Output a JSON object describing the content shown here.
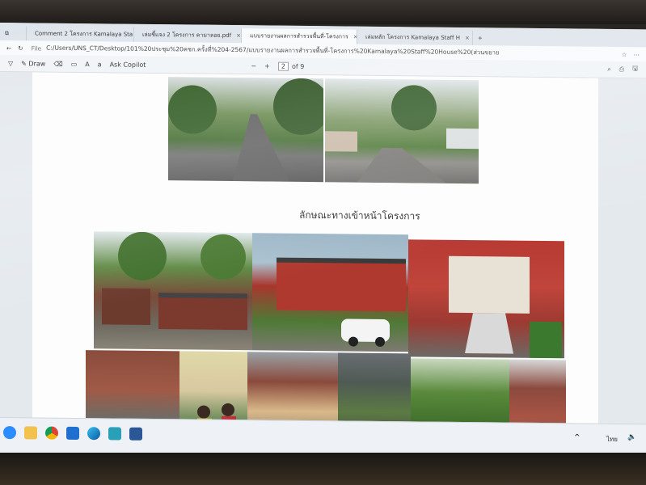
{
  "browser": {
    "tabs": [
      {
        "label": "Comment 2 โครงการ Kamalaya Sta"
      },
      {
        "label": "เล่มชี้แจง 2 โครงการ คามาลอย.pdf"
      },
      {
        "label": "แบบรายงานผลการสำรวจพื้นที่-โครงการ"
      },
      {
        "label": "เล่มหลัก โครงการ Kamalaya Staff H"
      }
    ],
    "new_tab": "+",
    "address": "C:/Users/UNS_CT/Desktop/101%20ประชุม%20คชก.ครั้งที่%204-2567/แบบรายงานผลการสำรวจพื้นที่-โครงการ%20Kamalaya%20Staff%20House%20(ส่วนขยาย).pdf",
    "file_label": "File"
  },
  "pdf_toolbar": {
    "draw_label": "Draw",
    "ask_copilot_label": "Ask Copilot",
    "page_number": "2",
    "page_total": "of 9"
  },
  "document": {
    "caption": "ลักษณะทางเข้าหน้าโครงการ"
  },
  "taskbar": {
    "icons": [
      "zoom-icon",
      "file-explorer-icon",
      "chrome-icon",
      "store-icon",
      "edge-icon",
      "photos-icon",
      "word-icon"
    ],
    "lang": "ไทย"
  }
}
